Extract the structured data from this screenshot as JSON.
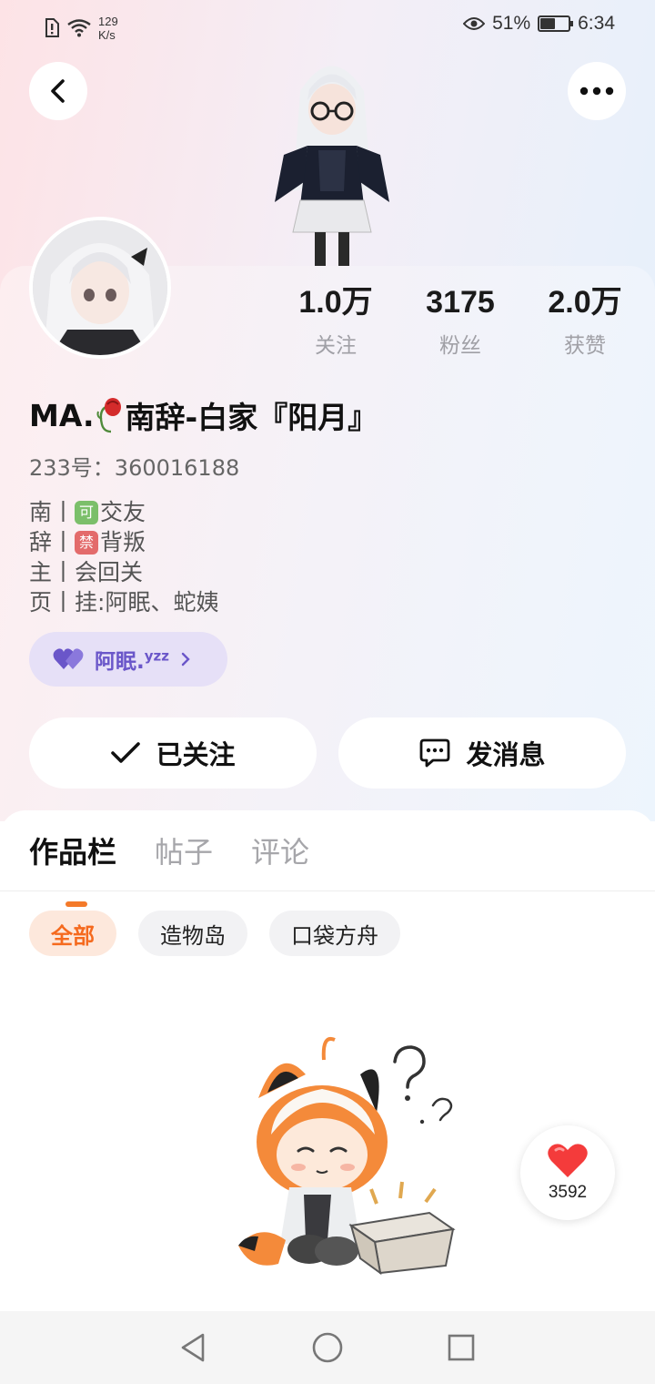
{
  "status_bar": {
    "net_speed_value": "129",
    "net_speed_unit": "K/s",
    "battery": "51%",
    "battery_level": 0.51,
    "time": "6:34"
  },
  "profile": {
    "name_prefix": "MA.",
    "name_rest": "南辞-白家『阳月』",
    "uid": "233号：360016188",
    "stats": [
      {
        "value": "1.0万",
        "label": "关注"
      },
      {
        "value": "3175",
        "label": "粉丝"
      },
      {
        "value": "2.0万",
        "label": "获赞"
      }
    ],
    "bio": [
      {
        "head": "南",
        "sep": "丨",
        "emoji": "可",
        "emoji_color": "#7bbf6a",
        "text": "交友"
      },
      {
        "head": "辞",
        "sep": "丨",
        "emoji": "禁",
        "emoji_color": "#e36b6b",
        "text": "背叛"
      },
      {
        "head": "主",
        "sep": "丨",
        "emoji": "",
        "text": "会回关"
      },
      {
        "head": "页",
        "sep": "丨",
        "emoji": "",
        "text": "挂:阿眠、蛇姨"
      }
    ],
    "tag": {
      "label": "阿眠.",
      "suffix": "yzz"
    }
  },
  "actions": {
    "follow": "已关注",
    "message": "发消息"
  },
  "tabs": [
    "作品栏",
    "帖子",
    "评论"
  ],
  "filters": [
    "全部",
    "造物岛",
    "口袋方舟"
  ],
  "like_fab": {
    "count": "3592"
  },
  "colors": {
    "accent": "#f47a2a",
    "tag_purple": "#6a56c9"
  }
}
